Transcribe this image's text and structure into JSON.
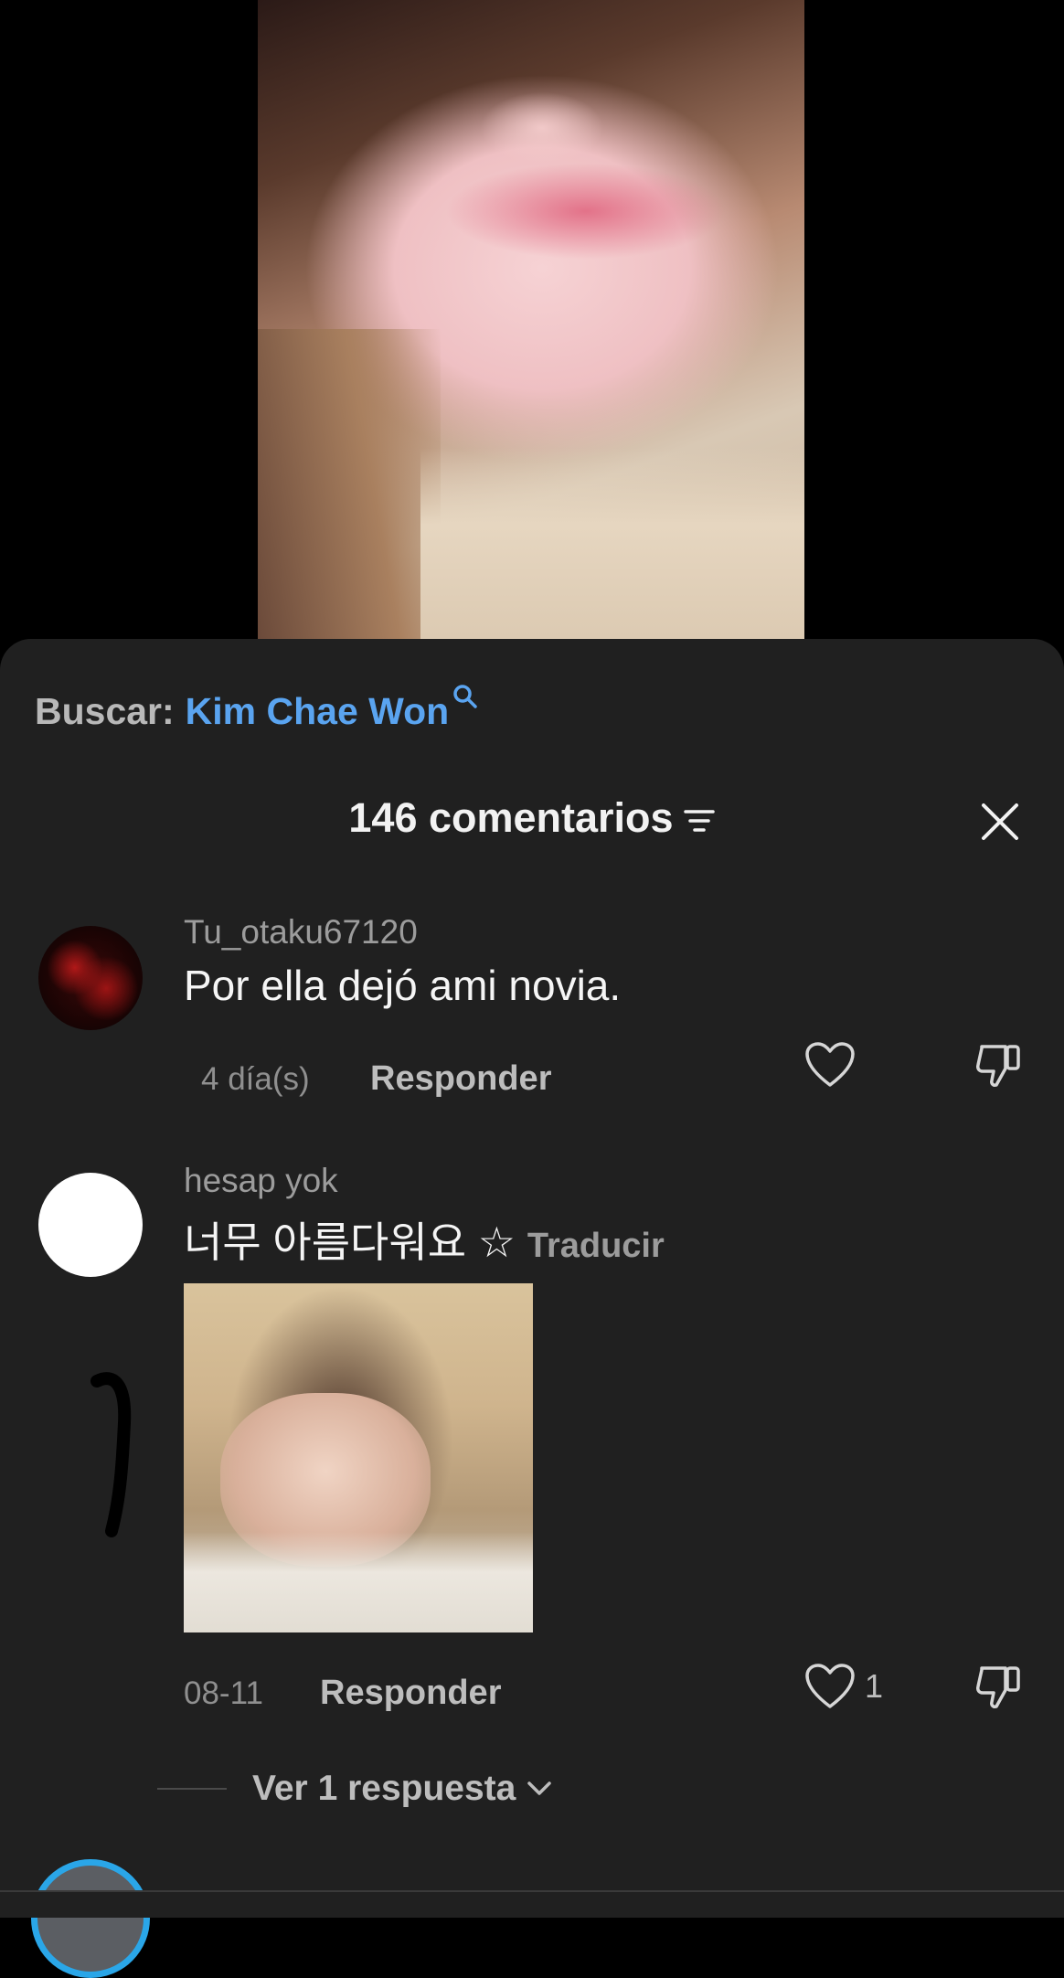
{
  "search": {
    "label": "Buscar:",
    "query": "Kim Chae Won"
  },
  "comments_header": {
    "title": "146 comentarios"
  },
  "comments": [
    {
      "username": "Tu_otaku67120",
      "text": "Por ella dejó ami novia.",
      "date": "4 día(s)",
      "reply_label": "Responder",
      "likes": ""
    },
    {
      "username": "hesap yok",
      "text": "너무 아름다워요 ☆",
      "translate_label": "Traducir",
      "date": "08-11",
      "reply_label": "Responder",
      "likes": "1",
      "view_replies_label": "Ver 1 respuesta"
    }
  ]
}
